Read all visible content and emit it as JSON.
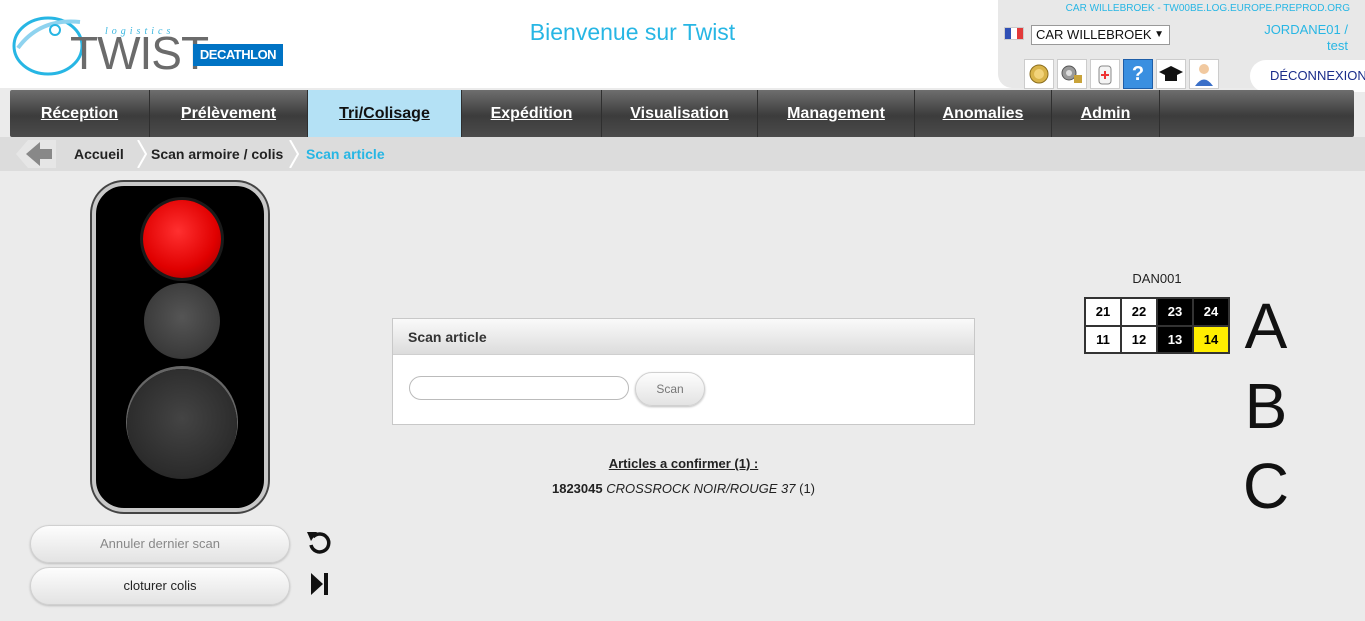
{
  "header": {
    "logo_small": "logistics",
    "logo_text": "TWIST",
    "brand": "DECATHLON",
    "welcome": "Bienvenue sur Twist",
    "server": "CAR WILLEBROEK - TW00BE.LOG.EUROPE.PREPROD.ORG",
    "site_select": "CAR WILLEBROEK",
    "user_line1": "JORDANE01 /",
    "user_line2": "test",
    "logout": "DÉCONNEXION",
    "tools": [
      "medal-icon",
      "gears-lock-icon",
      "first-aid-icon",
      "help-icon",
      "graduation-cap-icon",
      "user-support-icon"
    ]
  },
  "nav": {
    "items": [
      {
        "label": "Réception",
        "width": 140
      },
      {
        "label": "Prélèvement",
        "width": 158
      },
      {
        "label": "Tri/Colisage",
        "width": 154,
        "active": true
      },
      {
        "label": "Expédition",
        "width": 140
      },
      {
        "label": "Visualisation",
        "width": 156
      },
      {
        "label": "Management",
        "width": 157
      },
      {
        "label": "Anomalies",
        "width": 137
      },
      {
        "label": "Admin",
        "width": 108
      }
    ]
  },
  "breadcrumb": {
    "home": "Accueil",
    "level1": "Scan armoire / colis",
    "current": "Scan article"
  },
  "actions": {
    "cancel_last": "Annuler dernier scan",
    "close_parcel": "cloturer colis"
  },
  "scan": {
    "title": "Scan article",
    "input_value": "",
    "button": "Scan"
  },
  "confirm": {
    "title": "Articles a confirmer (1) :",
    "code": "1823045",
    "name": "CROSSROCK NOIR/ROUGE 37",
    "qty": "(1)"
  },
  "cabinet": {
    "label": "DAN001",
    "rows": [
      [
        {
          "v": "21",
          "s": "white"
        },
        {
          "v": "22",
          "s": "white"
        },
        {
          "v": "23",
          "s": "black"
        },
        {
          "v": "24",
          "s": "black"
        }
      ],
      [
        {
          "v": "11",
          "s": "white"
        },
        {
          "v": "12",
          "s": "white"
        },
        {
          "v": "13",
          "s": "black"
        },
        {
          "v": "14",
          "s": "yellow"
        }
      ]
    ],
    "letters": [
      "A",
      "B",
      "C"
    ]
  },
  "colors": {
    "accent": "#27b6e4",
    "nav_active": "#b4e1f5",
    "light_on": "#ff2020",
    "highlight": "#ffee00"
  },
  "traffic_light": {
    "active": "red"
  }
}
